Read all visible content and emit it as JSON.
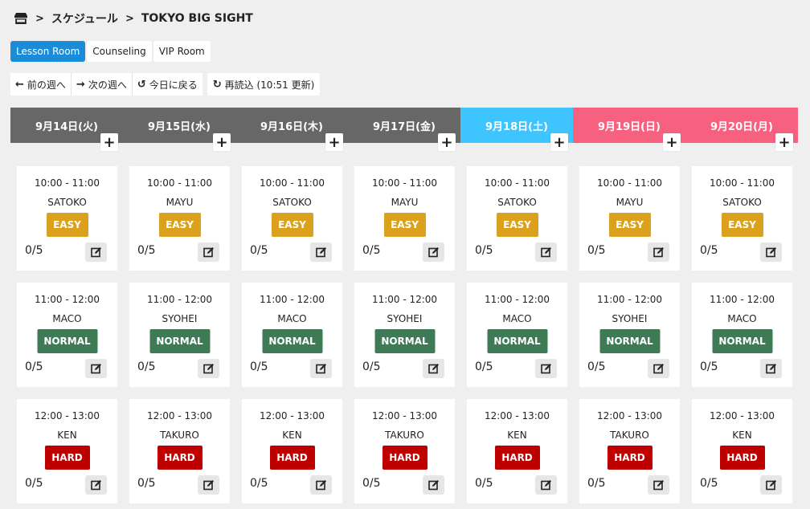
{
  "breadcrumb": {
    "icon": "store-icon",
    "items": [
      "スケジュール",
      "TOKYO BIG SIGHT"
    ]
  },
  "tabs": [
    {
      "label": "Lesson Room",
      "active": true
    },
    {
      "label": "Counseling",
      "active": false
    },
    {
      "label": "VIP Room",
      "active": false
    }
  ],
  "toolbar": {
    "prev_week": "前の週へ",
    "next_week": "次の週へ",
    "today": "今日に戻る",
    "reload": "再読込 (10:51 更新)"
  },
  "colors": {
    "weekday": "#676767",
    "saturday": "#3ec4ff",
    "sunday_holiday": "#f7617f",
    "easy": "#dba11c",
    "normal": "#3f7a56",
    "hard": "#be0000",
    "active_tab": "#1a8cd8"
  },
  "days": [
    {
      "label": "9月14日(火)",
      "type": "weekday"
    },
    {
      "label": "9月15日(水)",
      "type": "weekday"
    },
    {
      "label": "9月16日(木)",
      "type": "weekday"
    },
    {
      "label": "9月17日(金)",
      "type": "weekday"
    },
    {
      "label": "9月18日(土)",
      "type": "sat"
    },
    {
      "label": "9月19日(日)",
      "type": "sun"
    },
    {
      "label": "9月20日(月)",
      "type": "hol"
    }
  ],
  "add_label": "+",
  "slots": [
    {
      "time": "10:00 - 11:00",
      "level": "EASY",
      "level_class": "easy",
      "instructors": [
        "SATOKO",
        "MAYU",
        "SATOKO",
        "MAYU",
        "SATOKO",
        "MAYU",
        "SATOKO"
      ],
      "count": "0/5"
    },
    {
      "time": "11:00 - 12:00",
      "level": "NORMAL",
      "level_class": "normal",
      "instructors": [
        "MACO",
        "SYOHEI",
        "MACO",
        "SYOHEI",
        "MACO",
        "SYOHEI",
        "MACO"
      ],
      "count": "0/5"
    },
    {
      "time": "12:00 - 13:00",
      "level": "HARD",
      "level_class": "hard",
      "instructors": [
        "KEN",
        "TAKURO",
        "KEN",
        "TAKURO",
        "KEN",
        "TAKURO",
        "KEN"
      ],
      "count": "0/5"
    }
  ]
}
